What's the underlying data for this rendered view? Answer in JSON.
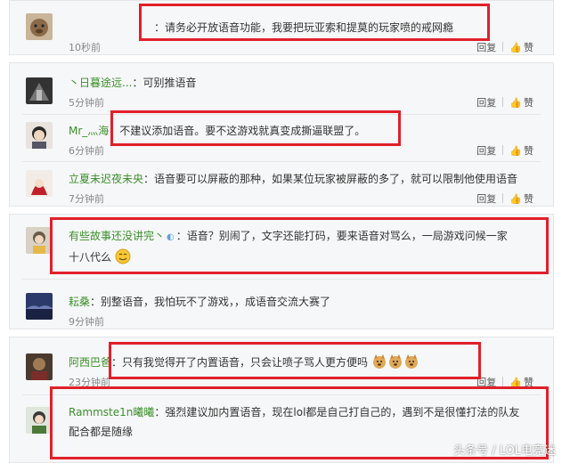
{
  "actions": {
    "reply": "回复",
    "like": "赞"
  },
  "comments": [
    {
      "user": "",
      "text": "：请务必开放语音功能，我要把玩亚索和提莫的玩家喷的戒网瘾",
      "time": "10秒前"
    },
    {
      "user": "丶日暮途远...",
      "text": "：可别推语音",
      "time": "5分钟前"
    },
    {
      "user": "Mr_灬海",
      "text": "：不建议添加语音。要不这游戏就真变成撕逼联盟了。",
      "time": "6分钟前"
    },
    {
      "user": "立夏未迟夜未央",
      "text": "：语音要可以屏蔽的那种，如果某位玩家被屏蔽的多了，就可以限制他使用语音",
      "time": "7分钟前"
    },
    {
      "user": "有些故事还没讲完丶",
      "text": "：语音？别闹了，文字还能打码，要来语音对骂么，一局游戏问候一家",
      "text2": "十八代么",
      "time": ""
    },
    {
      "user": "耘桑",
      "text": "：别整语音，我怕玩不了游戏，，成语音交流大赛了",
      "time": "9分钟前"
    },
    {
      "user": "阿西巴爸",
      "text": "：只有我觉得开了内置语音，只会让喷子骂人更方便吗",
      "time": "23分钟前"
    },
    {
      "user": "Rammste1n曦曦",
      "text": "：强烈建议加内置语音，现在lol都是自己打自己的，遇到不是很懂打法的队友",
      "text2": "配合都是随缘",
      "time": ""
    }
  ],
  "watermark": "头条号 / LOL电竞迷"
}
